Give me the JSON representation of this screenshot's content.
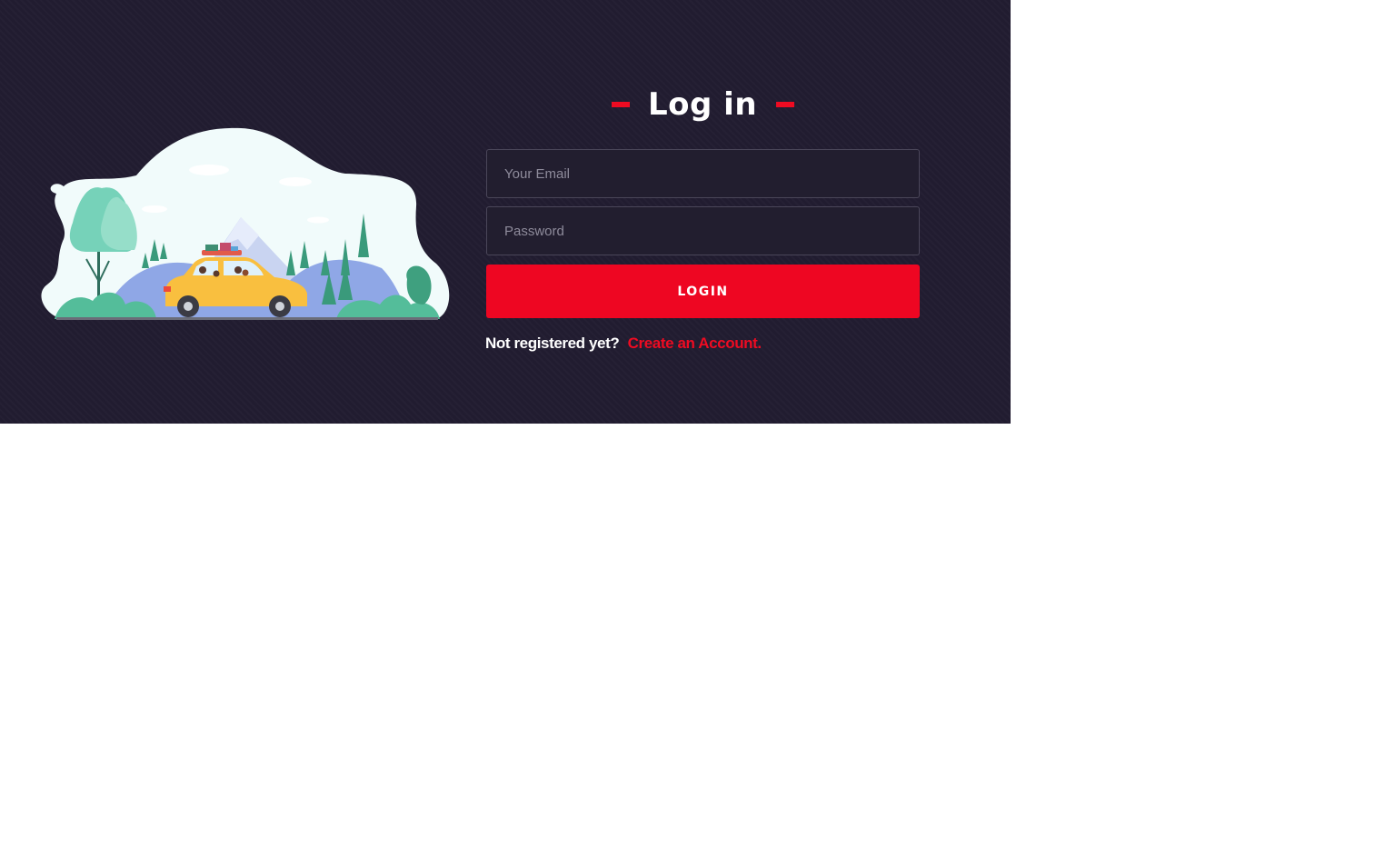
{
  "login": {
    "title": "Log in",
    "email_placeholder": "Your Email",
    "password_placeholder": "Password",
    "submit_label": "LOGIN",
    "register_prompt": "Not registered yet?",
    "register_link": "Create an Account."
  },
  "colors": {
    "background": "#211c30",
    "accent": "#ee0622",
    "input_background": "#221e2f",
    "input_border": "#4a4659",
    "text": "#ffffff",
    "placeholder": "#8e8b9b"
  },
  "illustration": {
    "icon": "car-road-trip-illustration"
  }
}
